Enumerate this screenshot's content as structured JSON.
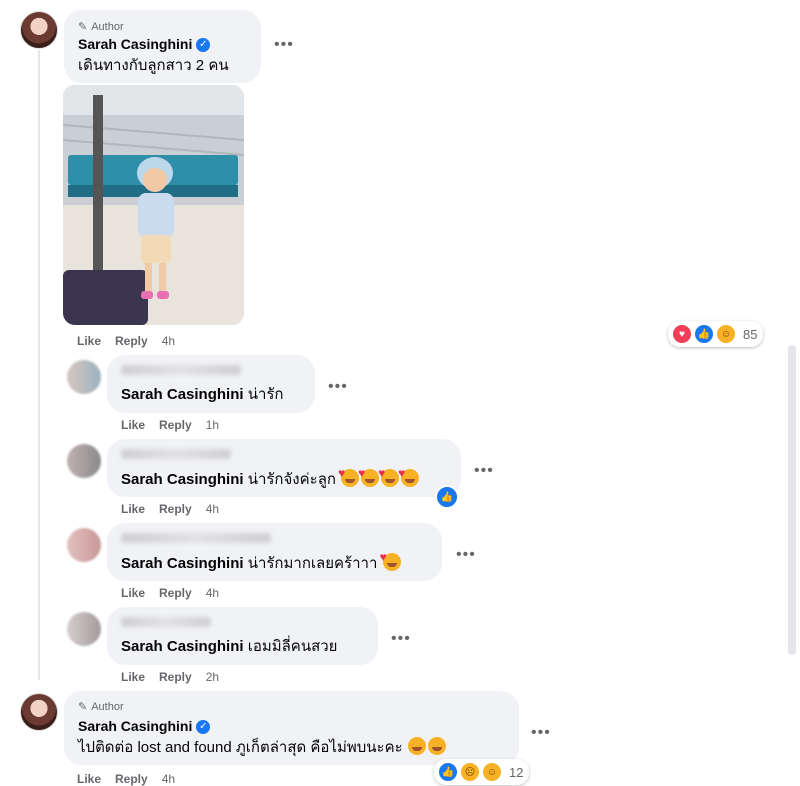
{
  "comments": [
    {
      "author_badge": "Author",
      "author_name": "Sarah Casinghini",
      "text": "เดินทางกับลูกสาว 2 คน",
      "actions": {
        "like": "Like",
        "reply": "Reply",
        "time": "4h"
      },
      "reactions": {
        "icons": [
          "love-icon",
          "like-icon",
          "care-icon"
        ],
        "count": "85"
      }
    }
  ],
  "replies": [
    {
      "tag": "Sarah Casinghini",
      "text": "น่ารัก",
      "emoji_count": 0,
      "actions": {
        "like": "Like",
        "reply": "Reply",
        "time": "1h"
      }
    },
    {
      "tag": "Sarah Casinghini",
      "text": "น่ารักจังค่ะลูก",
      "emoji_count": 4,
      "actions": {
        "like": "Like",
        "reply": "Reply",
        "time": "4h"
      },
      "reaction_icon": "like-icon"
    },
    {
      "tag": "Sarah Casinghini",
      "text": "น่ารักมากเลยคร้าาา",
      "emoji_count": 1,
      "actions": {
        "like": "Like",
        "reply": "Reply",
        "time": "4h"
      }
    },
    {
      "tag": "Sarah Casinghini",
      "text": "เอมมิลี่คนสวย",
      "emoji_count": 0,
      "actions": {
        "like": "Like",
        "reply": "Reply",
        "time": "2h"
      }
    }
  ],
  "author_reply": {
    "author_badge": "Author",
    "author_name": "Sarah Casinghini",
    "text": "ไปติดต่อ lost and found ภูเก็ตล่าสุด คือไม่พบนะคะ",
    "actions": {
      "like": "Like",
      "reply": "Reply",
      "time": "4h"
    },
    "reactions": {
      "icons": [
        "like-icon",
        "sad-icon",
        "care-icon"
      ],
      "count": "12"
    }
  },
  "more_label": "•••",
  "colors": {
    "bubble": "#f0f2f5",
    "like_blue": "#1877f2",
    "meta_gray": "#65676b"
  }
}
